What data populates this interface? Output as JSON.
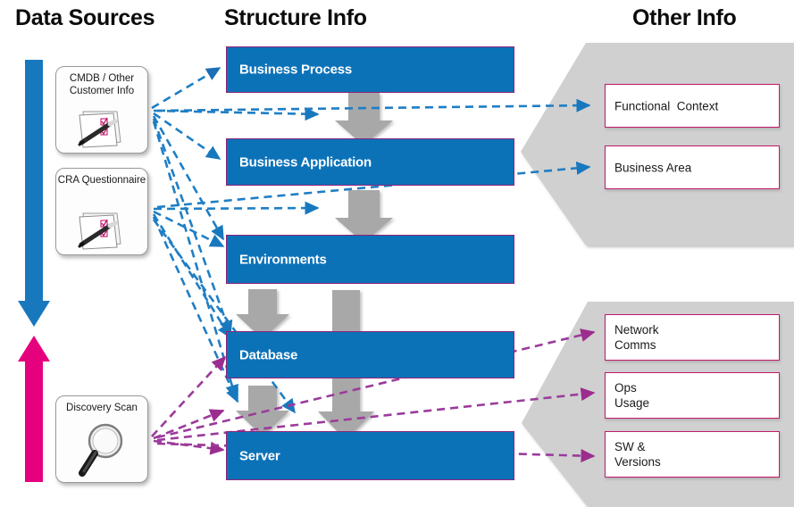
{
  "diagram": {
    "column_titles": {
      "data_sources": "Data Sources",
      "structure_info": "Structure Info",
      "other_info": "Other Info"
    },
    "colors": {
      "process_fill": "#0c72b8",
      "process_border": "#8e2379",
      "info_border": "#c2186c",
      "panel_gray": "#d0d0d0",
      "block_arrow_gray": "#a8a8a8",
      "blue_flow_arrow": "#1878be",
      "pink_flow_arrow": "#e5007e",
      "blue_dashed_line": "#1f7ec4",
      "purple_dashed_line": "#9b3b9b",
      "title_text": "#0c0c0c",
      "process_text": "#ffffff"
    },
    "data_sources": [
      {
        "id": "cmdb",
        "label": "CMDB / Other\nCustomer Info",
        "icon": "checklist-clipboard-icon"
      },
      {
        "id": "cra",
        "label": "CRA\nQuestionnaire",
        "icon": "checklist-clipboard-icon"
      },
      {
        "id": "discovery",
        "label": "Discovery Scan",
        "icon": "magnifying-glass-icon"
      }
    ],
    "flow_arrows": [
      {
        "id": "downward-blue-arrow",
        "direction": "down",
        "color": "#1878be",
        "name": "blue-down-arrow"
      },
      {
        "id": "upward-pink-arrow",
        "direction": "up",
        "color": "#e5007e",
        "name": "pink-up-arrow"
      }
    ],
    "structure_items": [
      {
        "id": "business-process",
        "label": "Business Process"
      },
      {
        "id": "business-application",
        "label": "Business Application"
      },
      {
        "id": "environments",
        "label": "Environments"
      },
      {
        "id": "database",
        "label": "Database"
      },
      {
        "id": "server",
        "label": "Server"
      }
    ],
    "other_info_top": [
      {
        "id": "functional-context",
        "label": "Functional  Context"
      },
      {
        "id": "business-area",
        "label": "Business Area"
      }
    ],
    "other_info_bottom": [
      {
        "id": "network-comms",
        "label": "Network\nComms"
      },
      {
        "id": "ops-usage",
        "label": "Ops\nUsage"
      },
      {
        "id": "sw-versions",
        "label": "SW &\nVersions"
      }
    ]
  }
}
